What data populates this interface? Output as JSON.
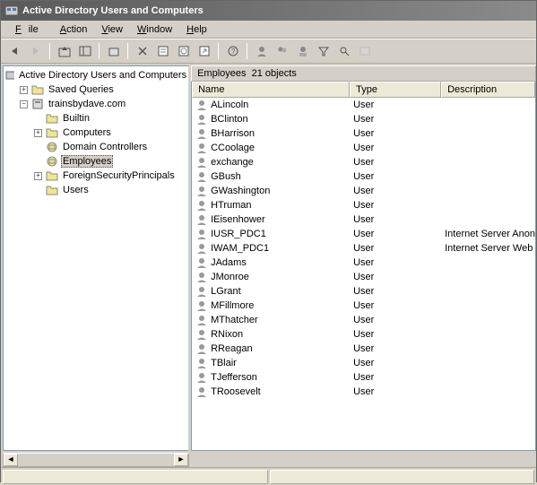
{
  "title": "Active Directory Users and Computers",
  "menu": {
    "file": "File",
    "action": "Action",
    "view": "View",
    "window": "Window",
    "help": "Help"
  },
  "tree": {
    "root": "Active Directory Users and Computers",
    "saved_queries": "Saved Queries",
    "domain": "trainsbydave.com",
    "builtin": "Builtin",
    "computers": "Computers",
    "domain_controllers": "Domain Controllers",
    "employees": "Employees",
    "fsp": "ForeignSecurityPrincipals",
    "users": "Users"
  },
  "list_header": {
    "path": "Employees",
    "count": "21 objects"
  },
  "columns": {
    "name": "Name",
    "type": "Type",
    "desc": "Description"
  },
  "rows": [
    {
      "name": "ALincoln",
      "type": "User",
      "desc": ""
    },
    {
      "name": "BClinton",
      "type": "User",
      "desc": ""
    },
    {
      "name": "BHarrison",
      "type": "User",
      "desc": ""
    },
    {
      "name": "CCoolage",
      "type": "User",
      "desc": ""
    },
    {
      "name": "exchange",
      "type": "User",
      "desc": ""
    },
    {
      "name": "GBush",
      "type": "User",
      "desc": ""
    },
    {
      "name": "GWashington",
      "type": "User",
      "desc": ""
    },
    {
      "name": "HTruman",
      "type": "User",
      "desc": ""
    },
    {
      "name": "IEisenhower",
      "type": "User",
      "desc": ""
    },
    {
      "name": "IUSR_PDC1",
      "type": "User",
      "desc": "Internet Server Anon"
    },
    {
      "name": "IWAM_PDC1",
      "type": "User",
      "desc": "Internet Server Web"
    },
    {
      "name": "JAdams",
      "type": "User",
      "desc": ""
    },
    {
      "name": "JMonroe",
      "type": "User",
      "desc": ""
    },
    {
      "name": "LGrant",
      "type": "User",
      "desc": ""
    },
    {
      "name": "MFillmore",
      "type": "User",
      "desc": ""
    },
    {
      "name": "MThatcher",
      "type": "User",
      "desc": ""
    },
    {
      "name": "RNixon",
      "type": "User",
      "desc": ""
    },
    {
      "name": "RReagan",
      "type": "User",
      "desc": ""
    },
    {
      "name": "TBlair",
      "type": "User",
      "desc": ""
    },
    {
      "name": "TJefferson",
      "type": "User",
      "desc": ""
    },
    {
      "name": "TRoosevelt",
      "type": "User",
      "desc": ""
    }
  ]
}
